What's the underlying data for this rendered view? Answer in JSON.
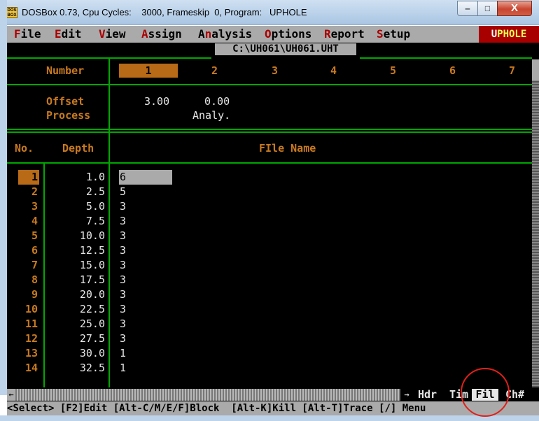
{
  "window": {
    "title": "DOSBox 0.73, Cpu Cycles:    3000, Frameskip  0, Program:   UPHOLE",
    "app_icon_text": "DOS BOX",
    "minimize_glyph": "‒",
    "maximize_glyph": "□",
    "close_glyph": "X"
  },
  "menu": {
    "items": [
      {
        "hot": "F",
        "rest": "ile"
      },
      {
        "hot": "E",
        "rest": "dit"
      },
      {
        "hot": "V",
        "rest": "iew"
      },
      {
        "hot": "A",
        "rest": "ssign"
      },
      {
        "pre": "A",
        "hot": "n",
        "rest": "alysis"
      },
      {
        "hot": "O",
        "rest": "ptions"
      },
      {
        "hot": "R",
        "rest": "eport"
      },
      {
        "hot": "S",
        "rest": "etup"
      }
    ],
    "brand_first": "U",
    "brand_rest": "PHOLE"
  },
  "file_path": "C:\\UH061\\UH061.UHT",
  "header": {
    "number_label": "Number",
    "columns": [
      "1",
      "2",
      "3",
      "4",
      "5",
      "6",
      "7"
    ],
    "offset_label": "Offset",
    "process_label": "Process",
    "offsets": [
      "3.00",
      "0.00"
    ],
    "process_value": "Analy."
  },
  "table": {
    "no_label": "No.",
    "depth_label": "Depth",
    "filename_label": "FIle Name",
    "rows": [
      {
        "no": "1",
        "depth": "1.0",
        "file": "6"
      },
      {
        "no": "2",
        "depth": "2.5",
        "file": "5"
      },
      {
        "no": "3",
        "depth": "5.0",
        "file": "3"
      },
      {
        "no": "4",
        "depth": "7.5",
        "file": "3"
      },
      {
        "no": "5",
        "depth": "10.0",
        "file": "3"
      },
      {
        "no": "6",
        "depth": "12.5",
        "file": "3"
      },
      {
        "no": "7",
        "depth": "15.0",
        "file": "3"
      },
      {
        "no": "8",
        "depth": "17.5",
        "file": "3"
      },
      {
        "no": "9",
        "depth": "20.0",
        "file": "3"
      },
      {
        "no": "10",
        "depth": "22.5",
        "file": "3"
      },
      {
        "no": "11",
        "depth": "25.0",
        "file": "3"
      },
      {
        "no": "12",
        "depth": "27.5",
        "file": "3"
      },
      {
        "no": "13",
        "depth": "30.0",
        "file": "1"
      },
      {
        "no": "14",
        "depth": "32.5",
        "file": "1"
      }
    ]
  },
  "bottom_tabs": {
    "arrow_left": "←",
    "arrow_right": "→",
    "hdr": "Hdr",
    "tim": "Tim",
    "fil": "Fil",
    "ch": "Ch#"
  },
  "status_line": "<Select> [F2]Edit [Alt-C/M/E/F]Block  [Alt-K]Kill [Alt-T]Trace [/] Menu",
  "colors": {
    "accent_orange": "#c97a20",
    "grid_green": "#00a800",
    "dos_background": "#000000",
    "annotation_circle": "#e0201a"
  }
}
